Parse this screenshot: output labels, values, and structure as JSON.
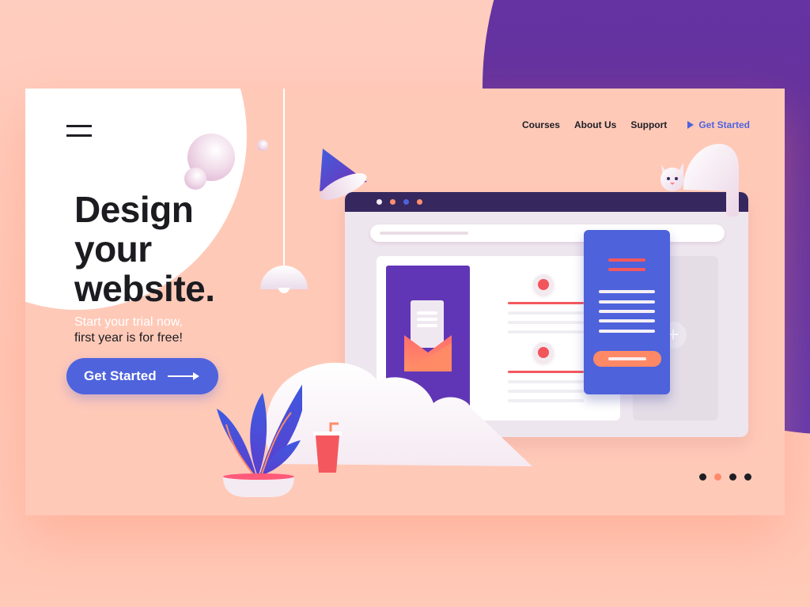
{
  "nav": {
    "menu_icon": "hamburger-menu-icon",
    "links": [
      {
        "label": "Courses"
      },
      {
        "label": "About Us"
      },
      {
        "label": "Support"
      }
    ],
    "cta": {
      "label": "Get Started",
      "icon": "play-triangle-icon"
    }
  },
  "hero": {
    "title_lines": [
      "Design",
      "your",
      "website."
    ],
    "subtitle_line1": "Start your trial now,",
    "subtitle_line2": "first year is for free!",
    "cta_label": "Get Started",
    "cta_icon": "arrow-right-icon"
  },
  "pager": {
    "count": 4,
    "active_index": 1
  },
  "illustration": {
    "browser_dots": [
      "#f3eef3",
      "#ff8f70",
      "#4d62db",
      "#ff8f70"
    ],
    "elements": [
      "hanging-lamp",
      "floating-spheres",
      "cone",
      "cat",
      "browser-window",
      "mail-card",
      "feed-list",
      "signup-form-card",
      "cloud",
      "potted-plant",
      "drink-cup"
    ]
  },
  "colors": {
    "accent_blue": "#4f63dd",
    "accent_purple": "#6136b6",
    "accent_coral": "#ff8966",
    "background_peach": "#ffc9b8",
    "text_dark": "#1b1b20",
    "browser_bar": "#36285e"
  }
}
